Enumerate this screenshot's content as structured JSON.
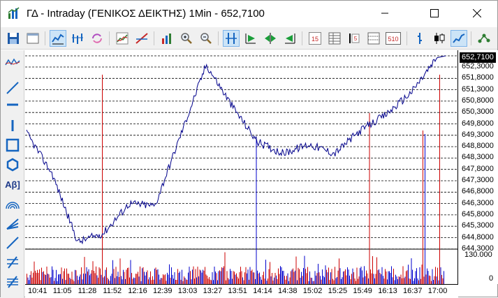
{
  "window": {
    "title": "ΓΔ - Intraday (ΓΕΝΙΚΟΣ ΔΕΙΚΤΗΣ) 1Min - 652,7100"
  },
  "toolbar": {
    "buttons": [
      "save-icon",
      "window-icon",
      "chart-lines-icon",
      "chart-bars-icon",
      "refresh-icon",
      "indicator-icon",
      "trendline-icon",
      "volume-icon",
      "zoom-in-icon",
      "zoom-out-icon",
      "crosshair-icon",
      "play-start-icon",
      "play-both-icon",
      "play-end-icon",
      "tick-icon",
      "table-icon",
      "ranges-icon",
      "grid-icon",
      "marker-icon",
      "candles-icon",
      "line-chart-icon",
      "network-icon"
    ],
    "active": [
      "chart-lines-icon",
      "crosshair-icon",
      "line-chart-icon"
    ],
    "labels": {
      "tick": "15",
      "grid": "510"
    }
  },
  "left_tools": [
    "line-study-icon",
    "diagonal-line-icon",
    "horizontal-line-icon",
    "vertical-line-icon",
    "rectangle-icon",
    "circle-icon",
    "text-icon",
    "arc-icon",
    "fan-icon",
    "line-icon",
    "fibonacci-icon",
    "channel-icon"
  ],
  "left_tools_text": {
    "text_tool": "Αβ]"
  },
  "chart": {
    "current_price": "652,7100",
    "price_labels": [
      "652,3000",
      "651,8000",
      "651,3000",
      "650,8000",
      "650,3000",
      "649,8000",
      "649,3000",
      "648,8000",
      "648,3000",
      "647,8000",
      "647,3000",
      "646,8000",
      "646,3000",
      "645,8000",
      "645,3000",
      "644,8000",
      "644,3000"
    ],
    "volume_labels": [
      "130.000",
      "0"
    ],
    "time_labels": [
      "10:41",
      "11:05",
      "11:28",
      "11:52",
      "12:16",
      "12:39",
      "13:03",
      "13:27",
      "13:51",
      "14:14",
      "14:38",
      "15:02",
      "15:25",
      "15:49",
      "16:13",
      "16:37",
      "17:00"
    ],
    "colors": {
      "price_line": "#00008b",
      "up_volume": "#0000cc",
      "down_volume": "#cc0000",
      "grid": "#000000"
    }
  },
  "chart_data": {
    "type": "line",
    "title": "",
    "xlabel": "",
    "ylabel": "",
    "ylim": [
      644.3,
      652.71
    ],
    "x": [
      "10:41",
      "11:05",
      "11:28",
      "11:52",
      "12:16",
      "12:39",
      "13:03",
      "13:27",
      "13:51",
      "14:14",
      "14:38",
      "15:02",
      "15:25",
      "15:49",
      "16:13",
      "16:37",
      "17:00"
    ],
    "series": [
      {
        "values": [
          649.4,
          647.6,
          644.6,
          645.0,
          646.3,
          646.2,
          649.3,
          652.4,
          650.6,
          649.0,
          648.5,
          648.9,
          648.5,
          649.5,
          650.2,
          651.2,
          652.71
        ]
      }
    ]
  }
}
